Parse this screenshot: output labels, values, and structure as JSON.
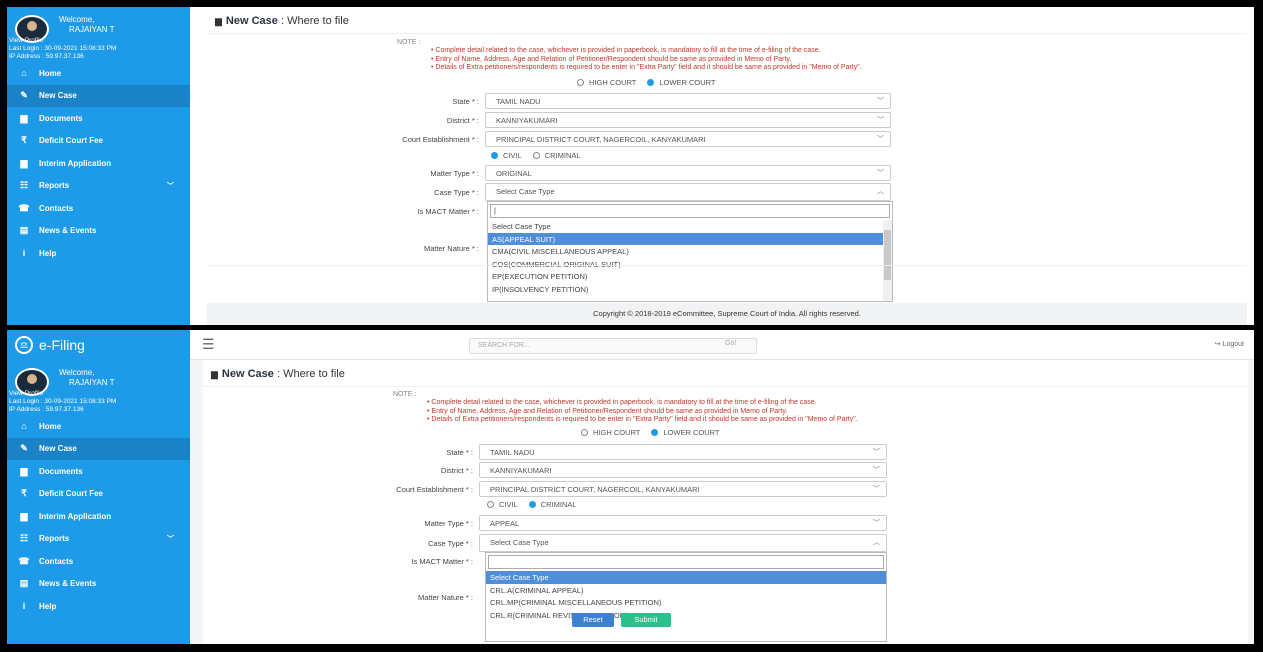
{
  "app": {
    "brand": "e-Filing"
  },
  "topbar": {
    "search_placeholder": "SEARCH FOR...",
    "go": "Go!",
    "logout": "Logout"
  },
  "profile": {
    "welcome": "Welcome,",
    "name": "RAJAIYAN T",
    "view_profile": "View Profile",
    "last_login": "Last Login : 30-09-2021 15:08:33 PM",
    "ip": "IP Address : 59.97.37.136"
  },
  "sidebar": {
    "items": [
      {
        "label": "Home",
        "icon": "home-icon"
      },
      {
        "label": "New Case",
        "icon": "edit-icon"
      },
      {
        "label": "Documents",
        "icon": "folder-icon"
      },
      {
        "label": "Deficit Court Fee",
        "icon": "rupee-icon"
      },
      {
        "label": "Interim Application",
        "icon": "folder-icon"
      },
      {
        "label": "Reports",
        "icon": "reports-icon"
      },
      {
        "label": "Contacts",
        "icon": "contacts-icon"
      },
      {
        "label": "News & Events",
        "icon": "news-icon"
      },
      {
        "label": "Help",
        "icon": "info-icon"
      }
    ]
  },
  "page": {
    "title_bold": "New Case",
    "title_rest": " : Where to file",
    "note_heading": "NOTE :",
    "notes": [
      "Complete detail related to the case, whichever is provided in paperbook, is mandatory to fill at the time of e-filing of the case.",
      "Entry of Name, Address, Age and Relation of Petitioner/Respondent should be same as provided in Memo of Party.",
      "Details of Extra petitioners/respondents is required to be enter in \"Extra Party\" field and it should be same as provided in \"Memo of Party\"."
    ],
    "court_options": [
      "HIGH COURT",
      "LOWER COURT"
    ],
    "matter_options": [
      "CIVIL",
      "CRIMINAL"
    ],
    "labels": {
      "state": "State * :",
      "district": "District * :",
      "court_establishment": "Court Establishment * :",
      "matter_type": "Matter Type * :",
      "case_type": "Case Type * :",
      "is_mact": "Is MACT Matter * :",
      "matter_nature": "Matter Nature * :"
    },
    "values": {
      "state": "TAMIL NADU",
      "district": "KANNIYAKUMARI",
      "court_establishment": "PRINCIPAL DISTRICT COURT, NAGERCOIL, KANYAKUMARI",
      "case_type_placeholder": "Select Case Type"
    }
  },
  "screen1": {
    "matter_type": "ORIGINAL",
    "search_text": "|",
    "options": [
      "Select Case Type",
      "AS(APPEAL SUIT)",
      "CMA(CIVIL MISCELLANEOUS APPEAL)",
      "COS(COMMERCIAL ORIGINAL SUIT)",
      "EP(EXECUTION PETITION)",
      "IP(INSOLVENCY PETITION)"
    ],
    "copyright": "Copyright © 2018-2019 eCommittee, Supreme Court of India. All rights reserved."
  },
  "screen2": {
    "matter_type": "APPEAL",
    "options": [
      "Select Case Type",
      "CRL.A(CRIMINAL APPEAL)",
      "CRL.MP(CRIMINAL MISCELLANEOUS PETITION)",
      "CRL.R(CRIMINAL REVISION PETITION)"
    ],
    "reset": "Reset",
    "submit": "Submit"
  },
  "colors": {
    "sidebar": "#1e9be8",
    "highlight": "#4f8fd9",
    "note": "#c0392b",
    "reset": "#3d7fd1",
    "submit": "#2cc08a"
  }
}
